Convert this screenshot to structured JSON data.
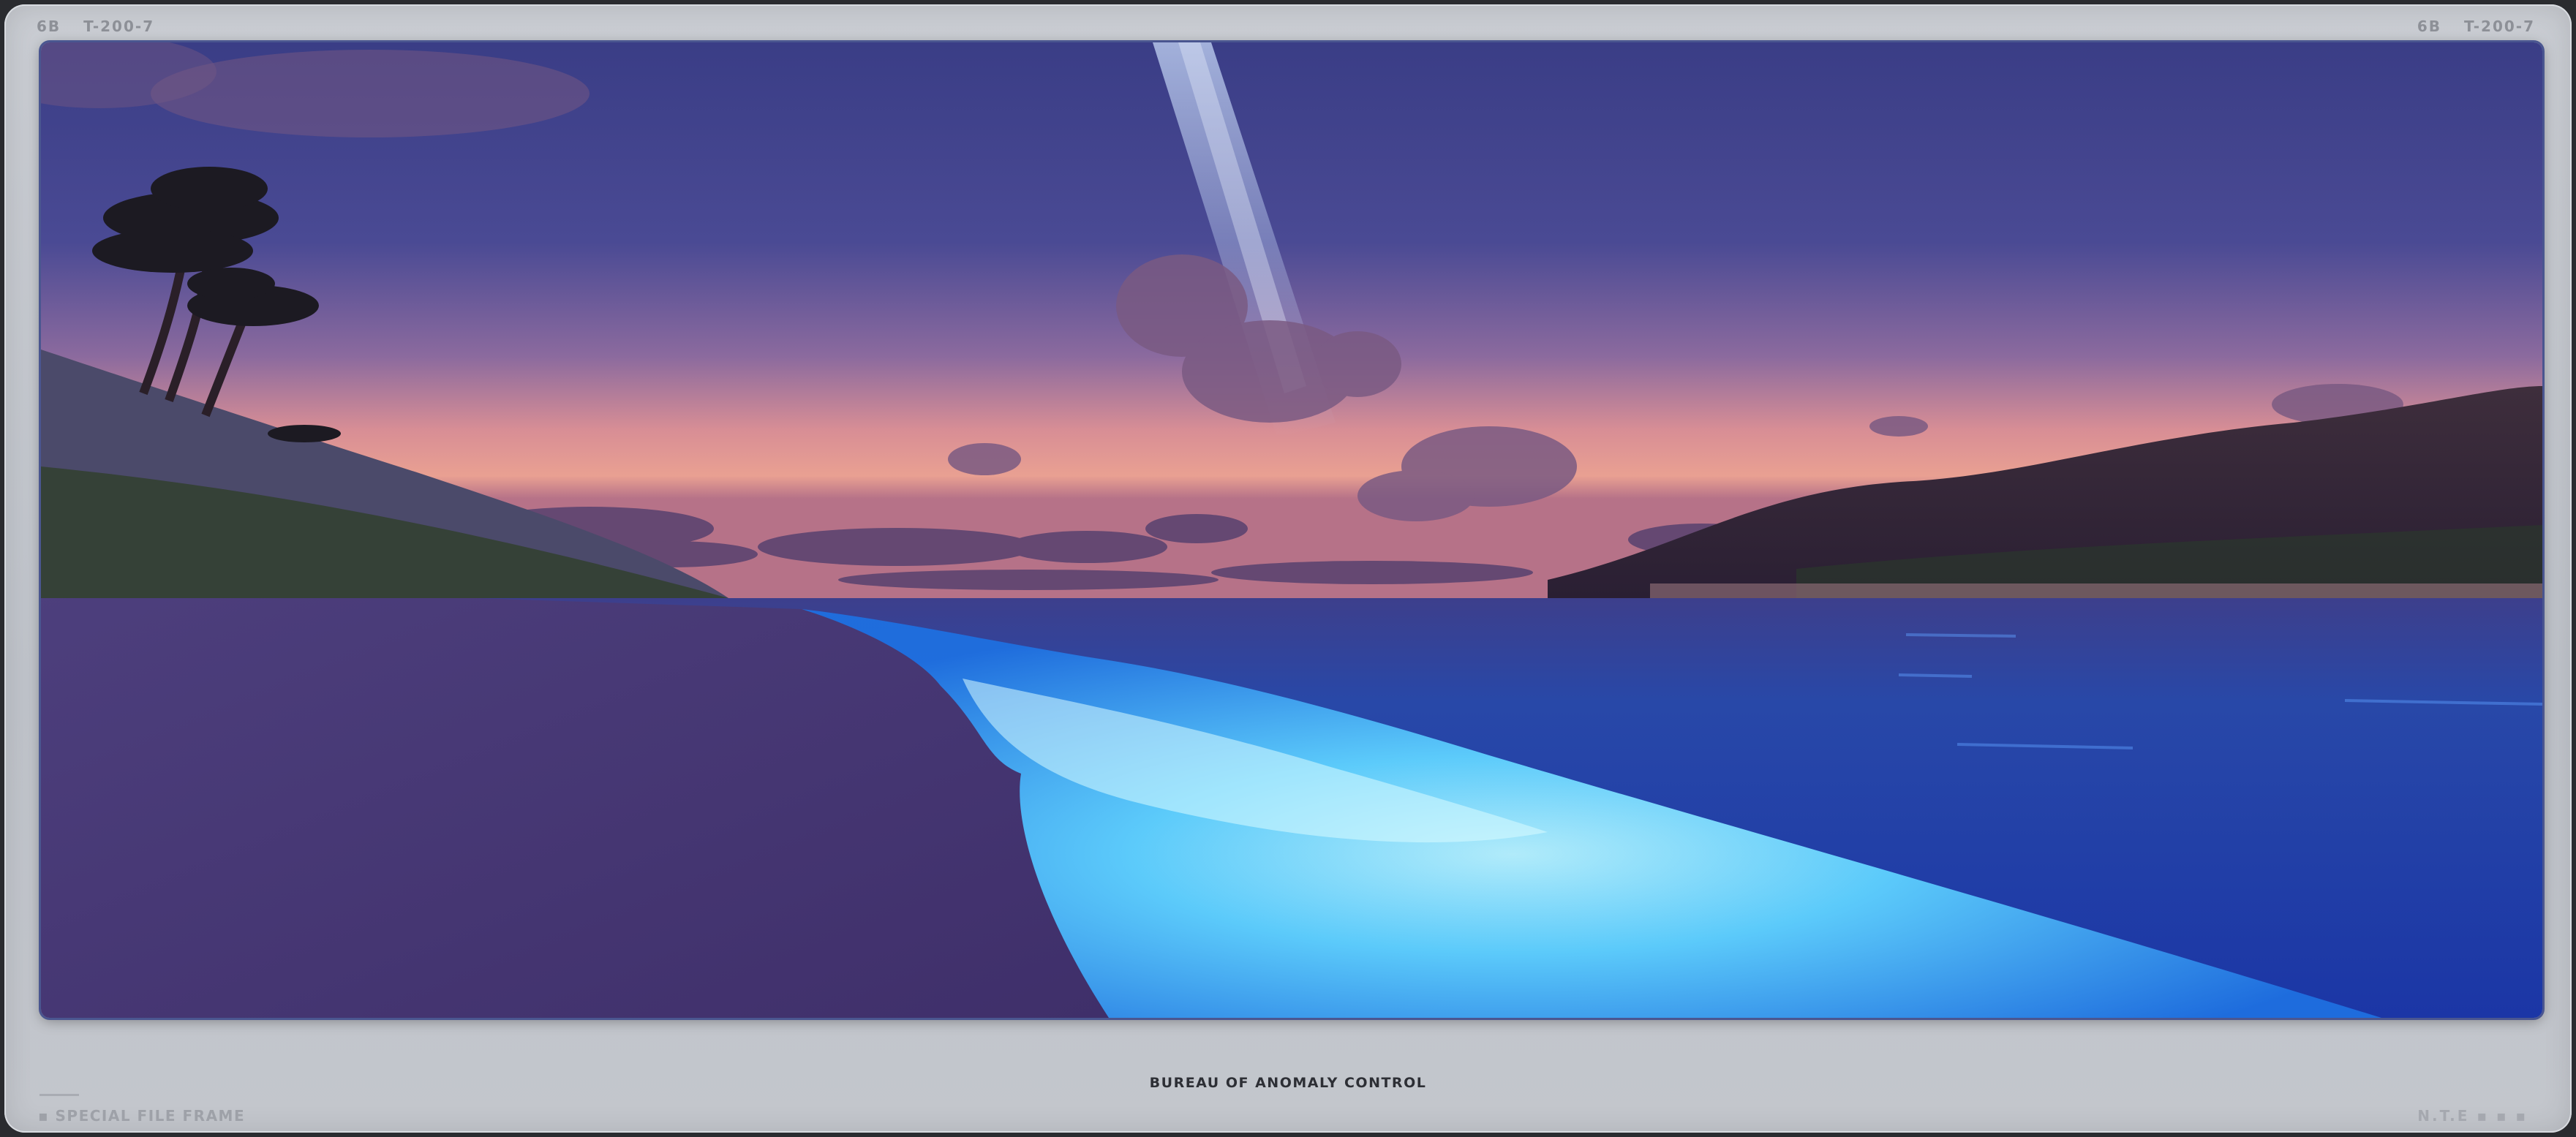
{
  "header": {
    "left_prefix": "6B",
    "left_code": "T-200-7",
    "right_prefix": "6B",
    "right_code": "T-200-7"
  },
  "scene": {
    "description_icon": "beach-night-scene-icon",
    "colors": {
      "sky_top": "#3b3f8a",
      "sky_horizon": "#e4968f",
      "sea": "#1f3fa8",
      "glow": "#7fe6ff",
      "sand": "#4a3b78"
    }
  },
  "footer": {
    "title": "BUREAU OF ANOMALY CONTROL",
    "left_label": "▪ SPECIAL FILE FRAME",
    "right_label": "N.T.E ▪ ▪ ▪"
  }
}
